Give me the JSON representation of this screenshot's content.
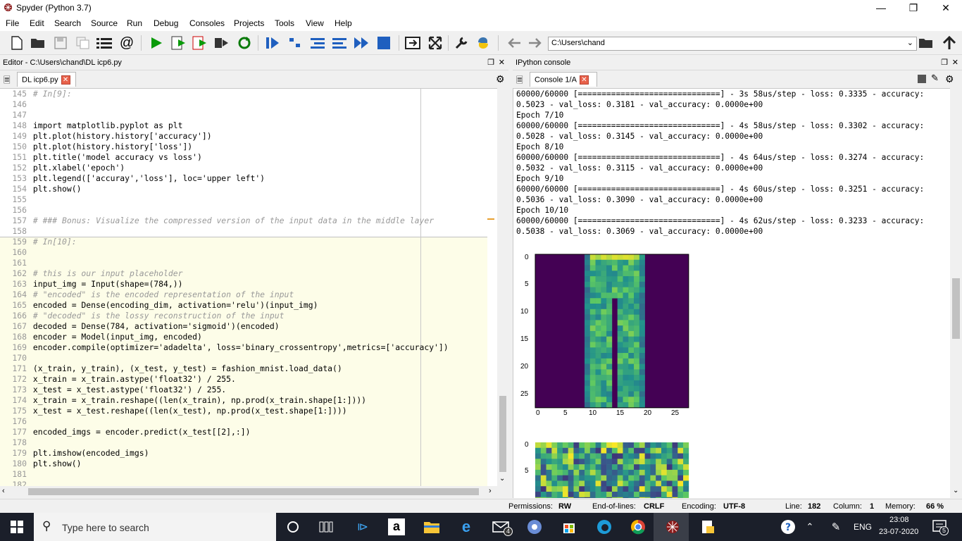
{
  "window": {
    "title": "Spyder (Python 3.7)"
  },
  "menu": [
    "File",
    "Edit",
    "Search",
    "Source",
    "Run",
    "Debug",
    "Consoles",
    "Projects",
    "Tools",
    "View",
    "Help"
  ],
  "toolbar": {
    "path": "C:\\Users\\chand"
  },
  "editor": {
    "header": "Editor - C:\\Users\\chand\\DL icp6.py",
    "tab": "DL icp6.py",
    "lines": [
      {
        "n": "145",
        "t": "# In[9]:"
      },
      {
        "n": "146",
        "t": ""
      },
      {
        "n": "147",
        "t": ""
      },
      {
        "n": "148",
        "t": "import matplotlib.pyplot as plt"
      },
      {
        "n": "149",
        "t": "plt.plot(history.history['accuracy'])"
      },
      {
        "n": "150",
        "t": "plt.plot(history.history['loss'])"
      },
      {
        "n": "151",
        "t": "plt.title('model accuracy vs loss')"
      },
      {
        "n": "152",
        "t": "plt.xlabel('epoch')"
      },
      {
        "n": "153",
        "t": "plt.legend(['accuray','loss'], loc='upper left')"
      },
      {
        "n": "154",
        "t": "plt.show()"
      },
      {
        "n": "155",
        "t": ""
      },
      {
        "n": "156",
        "t": ""
      },
      {
        "n": "157",
        "t": "# ### Bonus: Visualize the compressed version of the input data in the middle layer"
      },
      {
        "n": "158",
        "t": ""
      },
      {
        "n": "159",
        "t": "# In[10]:"
      },
      {
        "n": "160",
        "t": ""
      },
      {
        "n": "161",
        "t": ""
      },
      {
        "n": "162",
        "t": "# this is our input placeholder"
      },
      {
        "n": "163",
        "t": "input_img = Input(shape=(784,))"
      },
      {
        "n": "164",
        "t": "# \"encoded\" is the encoded representation of the input"
      },
      {
        "n": "165",
        "t": "encoded = Dense(encoding_dim, activation='relu')(input_img)"
      },
      {
        "n": "166",
        "t": "# \"decoded\" is the lossy reconstruction of the input"
      },
      {
        "n": "167",
        "t": "decoded = Dense(784, activation='sigmoid')(encoded)"
      },
      {
        "n": "168",
        "t": "encoder = Model(input_img, encoded)"
      },
      {
        "n": "169",
        "t": "encoder.compile(optimizer='adadelta', loss='binary_crossentropy',metrics=['accuracy'])"
      },
      {
        "n": "170",
        "t": ""
      },
      {
        "n": "171",
        "t": "(x_train, y_train), (x_test, y_test) = fashion_mnist.load_data()"
      },
      {
        "n": "172",
        "t": "x_train = x_train.astype('float32') / 255."
      },
      {
        "n": "173",
        "t": "x_test = x_test.astype('float32') / 255."
      },
      {
        "n": "174",
        "t": "x_train = x_train.reshape((len(x_train), np.prod(x_train.shape[1:])))"
      },
      {
        "n": "175",
        "t": "x_test = x_test.reshape((len(x_test), np.prod(x_test.shape[1:])))"
      },
      {
        "n": "176",
        "t": ""
      },
      {
        "n": "177",
        "t": "encoded_imgs = encoder.predict(x_test[[2],:])"
      },
      {
        "n": "178",
        "t": ""
      },
      {
        "n": "179",
        "t": "plt.imshow(encoded_imgs)"
      },
      {
        "n": "180",
        "t": "plt.show()"
      },
      {
        "n": "181",
        "t": ""
      },
      {
        "n": "182",
        "t": ""
      }
    ]
  },
  "console": {
    "header": "IPython console",
    "tab": "Console 1/A",
    "lines": [
      "60000/60000 [==============================] - 3s 58us/step - loss: 0.3335 - accuracy:",
      "0.5023 - val_loss: 0.3181 - val_accuracy: 0.0000e+00",
      "Epoch 7/10",
      "60000/60000 [==============================] - 4s 58us/step - loss: 0.3302 - accuracy:",
      "0.5028 - val_loss: 0.3145 - val_accuracy: 0.0000e+00",
      "Epoch 8/10",
      "60000/60000 [==============================] - 4s 64us/step - loss: 0.3274 - accuracy:",
      "0.5032 - val_loss: 0.3115 - val_accuracy: 0.0000e+00",
      "Epoch 9/10",
      "60000/60000 [==============================] - 4s 60us/step - loss: 0.3251 - accuracy:",
      "0.5036 - val_loss: 0.3090 - val_accuracy: 0.0000e+00",
      "Epoch 10/10",
      "60000/60000 [==============================] - 4s 62us/step - loss: 0.3233 - accuracy:",
      "0.5038 - val_loss: 0.3069 - val_accuracy: 0.0000e+00"
    ],
    "plot1": {
      "yticks": [
        "0",
        "5",
        "10",
        "15",
        "20",
        "25"
      ],
      "xticks": [
        "0",
        "5",
        "10",
        "15",
        "20",
        "25"
      ]
    },
    "plot2": {
      "yticks": [
        "0",
        "5"
      ]
    }
  },
  "status": {
    "permissions_label": "Permissions:",
    "permissions": "RW",
    "eol_label": "End-of-lines:",
    "eol": "CRLF",
    "encoding_label": "Encoding:",
    "encoding": "UTF-8",
    "line_label": "Line:",
    "line": "182",
    "column_label": "Column:",
    "column": "1",
    "memory_label": "Memory:",
    "memory": "66 %"
  },
  "taskbar": {
    "search_placeholder": "Type here to search",
    "lang": "ENG",
    "time": "23:08",
    "date": "23-07-2020",
    "mail_badge": "4",
    "notif_badge": "5"
  },
  "colors": {
    "accent": "#1c30c6",
    "string": "#008000",
    "comment": "#999999",
    "cell_bg": "#fdfde8",
    "viridis_low": "#440154",
    "viridis_high": "#fde725"
  }
}
